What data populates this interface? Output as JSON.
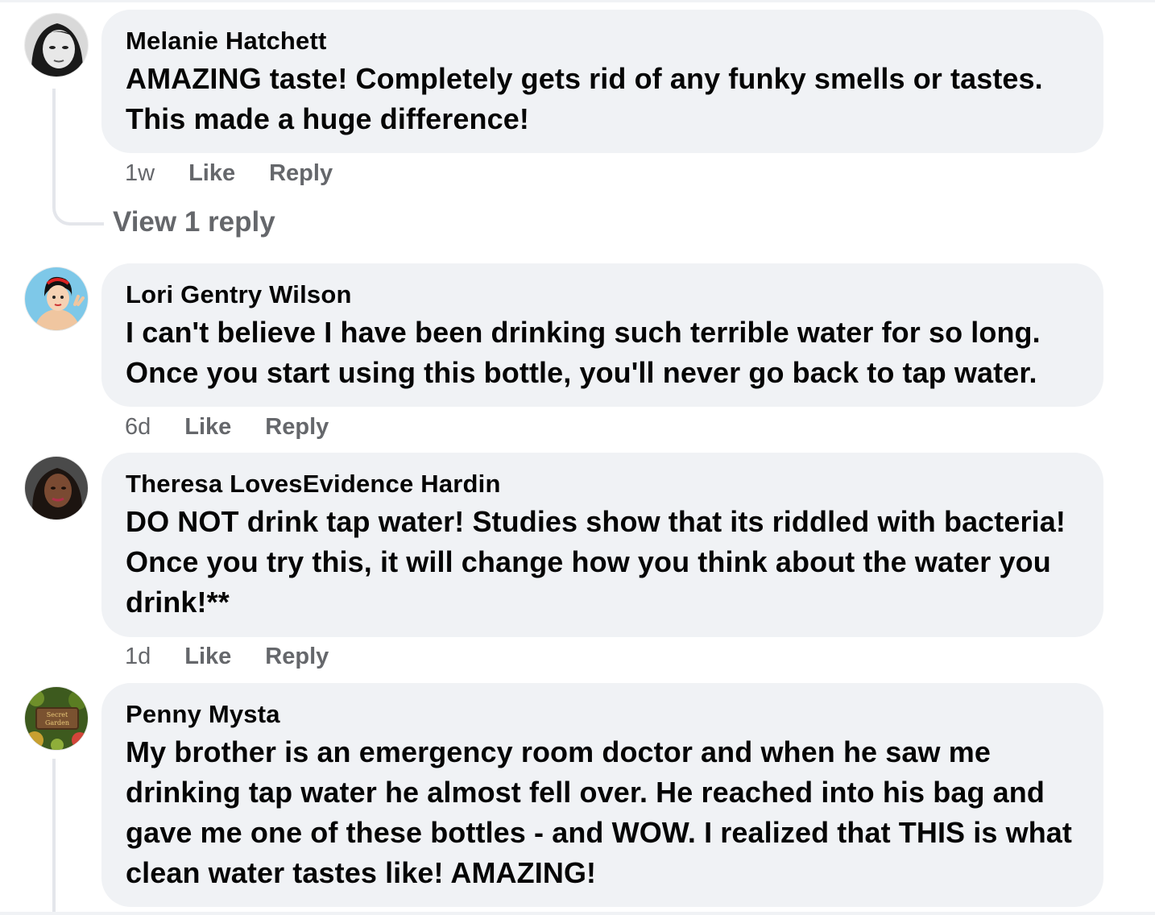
{
  "comments": [
    {
      "author": "Melanie Hatchett",
      "text": "AMAZING taste! Completely gets rid of any funky smells or tastes. This made a huge difference!",
      "time": "1w",
      "like_label": "Like",
      "reply_label": "Reply",
      "view_replies": "View 1 reply"
    },
    {
      "author": "Lori Gentry Wilson",
      "text": "I can't believe I have been drinking such terrible water for so long. Once you start using this bottle, you'll never go back to tap water.",
      "time": "6d",
      "like_label": "Like",
      "reply_label": "Reply"
    },
    {
      "author": "Theresa LovesEvidence Hardin",
      "text": "DO NOT drink tap water! Studies show that its riddled with bacteria! Once you try this, it will change how you think about the water you drink!**",
      "time": "1d",
      "like_label": "Like",
      "reply_label": "Reply"
    },
    {
      "author": "Penny Mysta",
      "text": "My brother is an emergency room doctor and when he saw me drinking tap water he almost fell over. He reached into his bag and gave me one of these bottles - and WOW. I realized that THIS is what clean water tastes like! AMAZING!"
    }
  ],
  "avatars": {
    "penny_sign_text": "Secret Garden"
  },
  "colors": {
    "bubble_bg": "#f0f2f5",
    "meta_text": "#65676b",
    "thread_line": "#e4e6eb"
  }
}
